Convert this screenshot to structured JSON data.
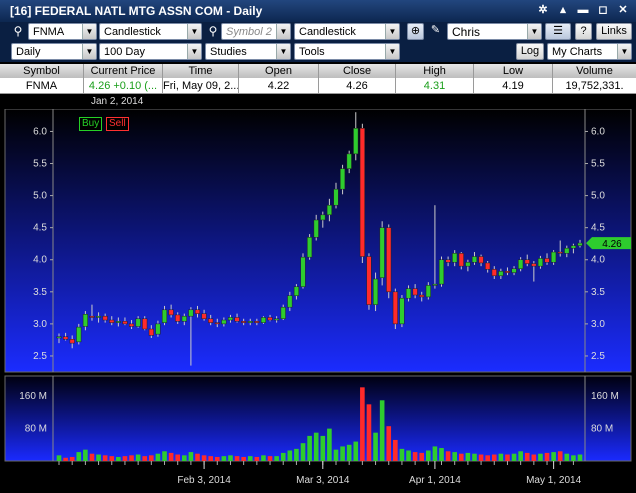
{
  "window": {
    "title": "[16] FEDERAL NATL MTG ASSN COM - Daily"
  },
  "toolbar": {
    "symbol_value": "FNMA",
    "chart_type": "Candlestick",
    "symbol2_placeholder": "Symbol 2",
    "chart_type2": "Candlestick",
    "user": "Chris",
    "links_label": "Links",
    "help_label": "?",
    "interval": "Daily",
    "range": "100 Day",
    "studies": "Studies",
    "tools": "Tools",
    "log_label": "Log",
    "my_charts": "My Charts"
  },
  "quote": {
    "headers": [
      "Symbol",
      "Current Price",
      "Time",
      "Open",
      "Close",
      "High",
      "Low",
      "Volume"
    ],
    "symbol": "FNMA",
    "current_price": "4.26 +0.10 (...",
    "time": "Fri, May 09, 2...",
    "open": "4.22",
    "close": "4.26",
    "high": "4.31",
    "low": "4.19",
    "volume": "19,752,331."
  },
  "chart": {
    "start_date": "Jan 2, 2014",
    "buy_label": "Buy",
    "sell_label": "Sell",
    "last_price_label": "4.26"
  },
  "colors": {
    "up": "#2ecc2e",
    "down": "#ff2a2a",
    "bg_top": "#000000",
    "bg_bottom": "#1b2cff",
    "axis_text": "#dddddd"
  },
  "chart_data": {
    "type": "candlestick",
    "price_ticks": [
      "6.0",
      "5.5",
      "5.0",
      "4.5",
      "4.0",
      "3.5",
      "3.0",
      "2.5"
    ],
    "volume_ticks": [
      "160 M",
      "80 M"
    ],
    "x_labels": [
      "Feb 3, 2014",
      "Mar 3, 2014",
      "Apr 1, 2014",
      "May 1, 2014"
    ],
    "ylim": [
      2.25,
      6.35
    ],
    "vlim": [
      0,
      210
    ],
    "ohlc": [
      [
        2.78,
        2.85,
        2.7,
        2.8
      ],
      [
        2.8,
        2.86,
        2.74,
        2.76
      ],
      [
        2.76,
        2.82,
        2.62,
        2.7
      ],
      [
        2.72,
        3.0,
        2.68,
        2.95
      ],
      [
        2.96,
        3.2,
        2.9,
        3.15
      ],
      [
        3.12,
        3.3,
        3.05,
        3.1
      ],
      [
        3.1,
        3.18,
        3.02,
        3.12
      ],
      [
        3.12,
        3.16,
        3.02,
        3.06
      ],
      [
        3.06,
        3.12,
        2.98,
        3.02
      ],
      [
        3.02,
        3.1,
        2.96,
        3.04
      ],
      [
        3.04,
        3.1,
        2.98,
        3.0
      ],
      [
        3.0,
        3.06,
        2.92,
        2.96
      ],
      [
        2.96,
        3.12,
        2.94,
        3.08
      ],
      [
        3.08,
        3.12,
        2.9,
        2.92
      ],
      [
        2.92,
        2.98,
        2.78,
        2.82
      ],
      [
        2.84,
        3.05,
        2.8,
        3.0
      ],
      [
        3.02,
        3.28,
        2.98,
        3.22
      ],
      [
        3.22,
        3.3,
        3.1,
        3.14
      ],
      [
        3.14,
        3.18,
        3.0,
        3.04
      ],
      [
        3.04,
        3.16,
        2.98,
        3.12
      ],
      [
        3.12,
        3.26,
        2.35,
        3.22
      ],
      [
        3.22,
        3.28,
        3.1,
        3.16
      ],
      [
        3.16,
        3.22,
        3.05,
        3.08
      ],
      [
        3.08,
        3.14,
        2.98,
        3.02
      ],
      [
        3.02,
        3.08,
        2.95,
        3.0
      ],
      [
        3.0,
        3.1,
        2.96,
        3.06
      ],
      [
        3.06,
        3.14,
        3.02,
        3.1
      ],
      [
        3.1,
        3.16,
        3.02,
        3.04
      ],
      [
        3.04,
        3.08,
        2.98,
        3.02
      ],
      [
        3.02,
        3.08,
        2.98,
        3.04
      ],
      [
        3.04,
        3.08,
        2.98,
        3.02
      ],
      [
        3.02,
        3.12,
        3.0,
        3.1
      ],
      [
        3.1,
        3.14,
        3.04,
        3.06
      ],
      [
        3.06,
        3.12,
        3.02,
        3.08
      ],
      [
        3.08,
        3.3,
        3.06,
        3.26
      ],
      [
        3.26,
        3.5,
        3.2,
        3.44
      ],
      [
        3.44,
        3.62,
        3.38,
        3.58
      ],
      [
        3.58,
        4.1,
        3.55,
        4.04
      ],
      [
        4.04,
        4.4,
        4.0,
        4.35
      ],
      [
        4.35,
        4.7,
        4.3,
        4.62
      ],
      [
        4.62,
        4.75,
        4.5,
        4.7
      ],
      [
        4.7,
        4.95,
        4.6,
        4.85
      ],
      [
        4.85,
        5.2,
        4.8,
        5.1
      ],
      [
        5.1,
        5.48,
        5.02,
        5.42
      ],
      [
        5.42,
        5.7,
        5.35,
        5.65
      ],
      [
        5.65,
        6.3,
        5.55,
        6.05
      ],
      [
        6.05,
        6.12,
        3.95,
        4.05
      ],
      [
        4.05,
        4.1,
        3.22,
        3.3
      ],
      [
        3.3,
        3.8,
        3.2,
        3.7
      ],
      [
        3.72,
        4.6,
        3.6,
        4.5
      ],
      [
        4.5,
        4.55,
        3.4,
        3.5
      ],
      [
        3.5,
        3.55,
        2.92,
        3.0
      ],
      [
        3.0,
        3.45,
        2.95,
        3.4
      ],
      [
        3.4,
        3.6,
        3.35,
        3.55
      ],
      [
        3.55,
        3.62,
        3.4,
        3.45
      ],
      [
        3.45,
        3.5,
        3.35,
        3.42
      ],
      [
        3.42,
        3.65,
        3.38,
        3.6
      ],
      [
        3.6,
        4.85,
        3.55,
        3.62
      ],
      [
        3.62,
        4.05,
        3.58,
        4.0
      ],
      [
        4.0,
        4.05,
        3.9,
        3.96
      ],
      [
        3.96,
        4.15,
        3.9,
        4.1
      ],
      [
        4.1,
        4.12,
        3.85,
        3.9
      ],
      [
        3.9,
        4.0,
        3.82,
        3.96
      ],
      [
        3.96,
        4.12,
        3.92,
        4.05
      ],
      [
        4.05,
        4.08,
        3.9,
        3.95
      ],
      [
        3.95,
        3.98,
        3.8,
        3.85
      ],
      [
        3.85,
        3.9,
        3.7,
        3.75
      ],
      [
        3.75,
        3.86,
        3.7,
        3.82
      ],
      [
        3.82,
        3.88,
        3.76,
        3.8
      ],
      [
        3.8,
        3.9,
        3.76,
        3.86
      ],
      [
        3.86,
        4.04,
        3.82,
        4.0
      ],
      [
        4.0,
        4.08,
        3.9,
        3.94
      ],
      [
        3.94,
        3.98,
        3.66,
        3.9
      ],
      [
        3.9,
        4.06,
        3.86,
        4.02
      ],
      [
        4.02,
        4.1,
        3.92,
        3.96
      ],
      [
        3.96,
        4.15,
        3.92,
        4.12
      ],
      [
        4.12,
        4.3,
        4.05,
        4.1
      ],
      [
        4.1,
        4.22,
        4.04,
        4.18
      ],
      [
        4.18,
        4.25,
        4.1,
        4.22
      ],
      [
        4.22,
        4.31,
        4.19,
        4.26
      ]
    ],
    "volumes": [
      14,
      8,
      10,
      22,
      28,
      18,
      16,
      14,
      12,
      10,
      12,
      14,
      16,
      12,
      14,
      18,
      24,
      20,
      16,
      14,
      22,
      18,
      14,
      12,
      10,
      12,
      14,
      12,
      10,
      12,
      10,
      14,
      12,
      12,
      20,
      26,
      30,
      44,
      62,
      70,
      62,
      80,
      28,
      36,
      40,
      48,
      182,
      140,
      70,
      150,
      86,
      52,
      30,
      26,
      22,
      20,
      26,
      36,
      32,
      24,
      22,
      18,
      20,
      18,
      16,
      14,
      16,
      18,
      16,
      18,
      24,
      20,
      16,
      18,
      20,
      22,
      24,
      18,
      14,
      16
    ],
    "label_positions": [
      22,
      40,
      57,
      75
    ]
  }
}
